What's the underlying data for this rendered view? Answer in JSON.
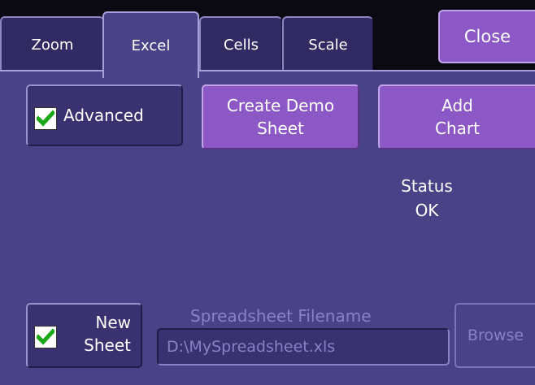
{
  "tabs": [
    {
      "label": "Zoom",
      "active": false
    },
    {
      "label": "Excel",
      "active": true
    },
    {
      "label": "Cells",
      "active": false
    },
    {
      "label": "Scale",
      "active": false
    }
  ],
  "close_label": "Close",
  "advanced": {
    "label": "Advanced",
    "checked": true
  },
  "create_demo_sheet": {
    "line1": "Create Demo",
    "line2": "Sheet"
  },
  "add_chart": {
    "line1": "Add",
    "line2": "Chart"
  },
  "status": {
    "label": "Status",
    "value": "OK"
  },
  "new_sheet": {
    "line1": "New",
    "line2": "Sheet",
    "checked": true
  },
  "spreadsheet_filename": {
    "label": "Spreadsheet Filename",
    "value": "D:\\MySpreadsheet.xls"
  },
  "browse_label": "Browse",
  "colors": {
    "panel_bg": "#4a4287",
    "tab_bg": "#322a63",
    "button_purple": "#8b58c6",
    "check_green": "#1aa81a",
    "disabled_text": "#8a80c6"
  }
}
